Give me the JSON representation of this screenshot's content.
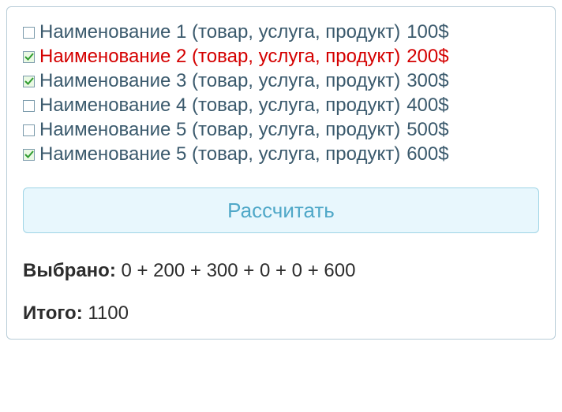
{
  "items": [
    {
      "label": "Наименование 1 (товар, услуга, продукт)",
      "price": "100$",
      "checked": false,
      "highlight": false
    },
    {
      "label": "Наименование 2 (товар, услуга, продукт)",
      "price": "200$",
      "checked": true,
      "highlight": true
    },
    {
      "label": "Наименование 3 (товар, услуга, продукт)",
      "price": "300$",
      "checked": true,
      "highlight": false
    },
    {
      "label": "Наименование 4 (товар, услуга, продукт)",
      "price": "400$",
      "checked": false,
      "highlight": false
    },
    {
      "label": "Наименование 5 (товар, услуга, продукт)",
      "price": "500$",
      "checked": false,
      "highlight": false
    },
    {
      "label": "Наименование 5 (товар, услуга, продукт)",
      "price": "600$",
      "checked": true,
      "highlight": false
    }
  ],
  "calc_button_label": "Рассчитать",
  "selected_label": "Выбрано:",
  "selected_expr": "0 + 200 + 300 + 0 + 0 + 600",
  "total_label": "Итого:",
  "total_value": "1100"
}
